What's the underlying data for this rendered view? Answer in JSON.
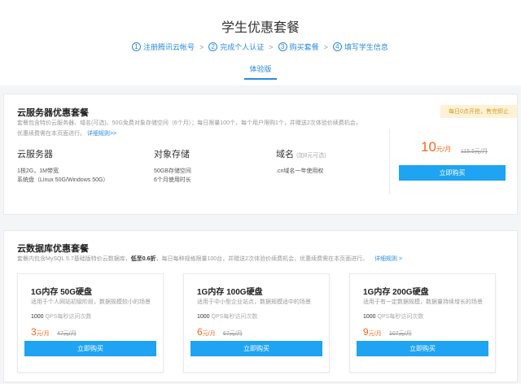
{
  "page": {
    "title": "学生优惠套餐",
    "tab": "体验版"
  },
  "steps": [
    {
      "num": "1",
      "label": "注册腾讯云帐号"
    },
    {
      "num": "2",
      "label": "完成个人认证"
    },
    {
      "num": "3",
      "label": "购买套餐"
    },
    {
      "num": "4",
      "label": "填写学生信息"
    }
  ],
  "step_sep": ">",
  "server_pkg": {
    "title": "云服务器优惠套餐",
    "desc_line1": "套餐包含特价云服务器、域名(可选)、50G免费对象存储空间（6个月）；每日限量100个，每个用户限购1个，并赠送2次体验价续费机会，",
    "desc_line2": "优惠续费需在本页面进行。",
    "details_link": "详细规则>>",
    "badge": "每日0点开抢，售完即止",
    "products": [
      {
        "name": "云服务器",
        "note": "",
        "lines": [
          "1核2G，1M带宽",
          "系统盘（Linux 50G/Windows 50G）"
        ]
      },
      {
        "name": "对象存储",
        "note": "",
        "lines": [
          "50GB存储空间",
          "6个月使用时长"
        ]
      },
      {
        "name": "域名",
        "note": "(加8元可选)",
        "lines": [
          ".cn域名一年使用权"
        ]
      }
    ],
    "price": "10",
    "price_unit": "元/月",
    "old_price": "115.5元/月",
    "buy_label": "立即购买"
  },
  "db_pkg": {
    "title": "云数据库优惠套餐",
    "desc_a": "套餐内包含MySQL 5.7基础版特价云数据库，",
    "desc_strong": "低至0.6折",
    "desc_b": "，每日每种规格限量100台，并赠送2次体验价续费机会，优惠续费需在本页面进行。",
    "details_link": "详细规则 >",
    "cards": [
      {
        "name": "1G内存 50G硬盘",
        "desc": "适用于个人网站初级阶段，数据规模较小的场景",
        "qps": "1000",
        "qps_label": "QPS每秒访问次数",
        "price": "3",
        "unit": "元/月",
        "old": "47元/月",
        "buy": "立即购买"
      },
      {
        "name": "1G内存 100G硬盘",
        "desc": "适用于中小型企业站点，数据规模适中的场景",
        "qps": "1000",
        "qps_label": "QPS每秒访问次数",
        "price": "6",
        "unit": "元/月",
        "old": "67元/月",
        "buy": "立即购买"
      },
      {
        "name": "1G内存 200G硬盘",
        "desc": "适用于有一定数据规模，数据量持续增长的场景",
        "qps": "1000",
        "qps_label": "QPS每秒访问次数",
        "price": "9",
        "unit": "元/月",
        "old": "107元/月",
        "buy": "立即购买"
      }
    ]
  }
}
